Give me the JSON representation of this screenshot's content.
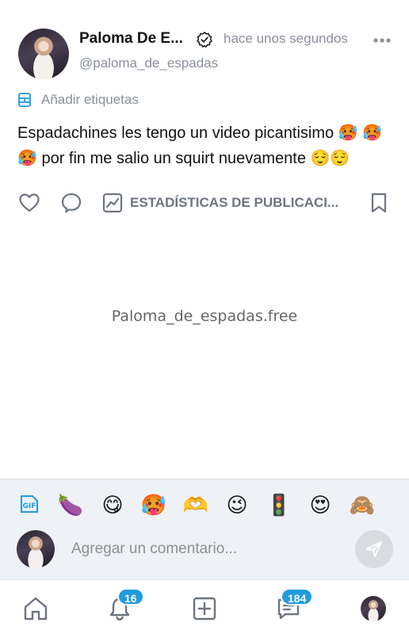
{
  "post": {
    "author_name": "Paloma De E...",
    "time_ago": "hace unos segundos",
    "handle": "@paloma_de_espadas",
    "tags_label": "Añadir etiquetas",
    "text": "Espadachines les tengo un video picantisimo 🥵 🥵🥵 por fin me salio un squirt nuevamente 😌😌",
    "stats_label": "ESTADÍSTICAS DE PUBLICACI...",
    "media_caption": "Paloma_de_espadas.free"
  },
  "composer": {
    "emojis": [
      "🍆",
      "😋",
      "🥵",
      "🫶",
      "😉",
      "🚦",
      "😍",
      "🙈"
    ],
    "placeholder": "Agregar un comentario..."
  },
  "nav": {
    "notifications_badge": "16",
    "messages_badge": "184"
  },
  "colors": {
    "accent": "#1f9bde",
    "muted_text": "#8a8f98",
    "composer_bg": "#eef1f6"
  },
  "icons": [
    "verified-icon",
    "more-icon",
    "tag-icon",
    "heart-icon",
    "comment-icon",
    "stats-icon",
    "bookmark-icon",
    "gif-icon",
    "send-icon",
    "home-icon",
    "bell-icon",
    "add-icon",
    "messages-icon"
  ]
}
